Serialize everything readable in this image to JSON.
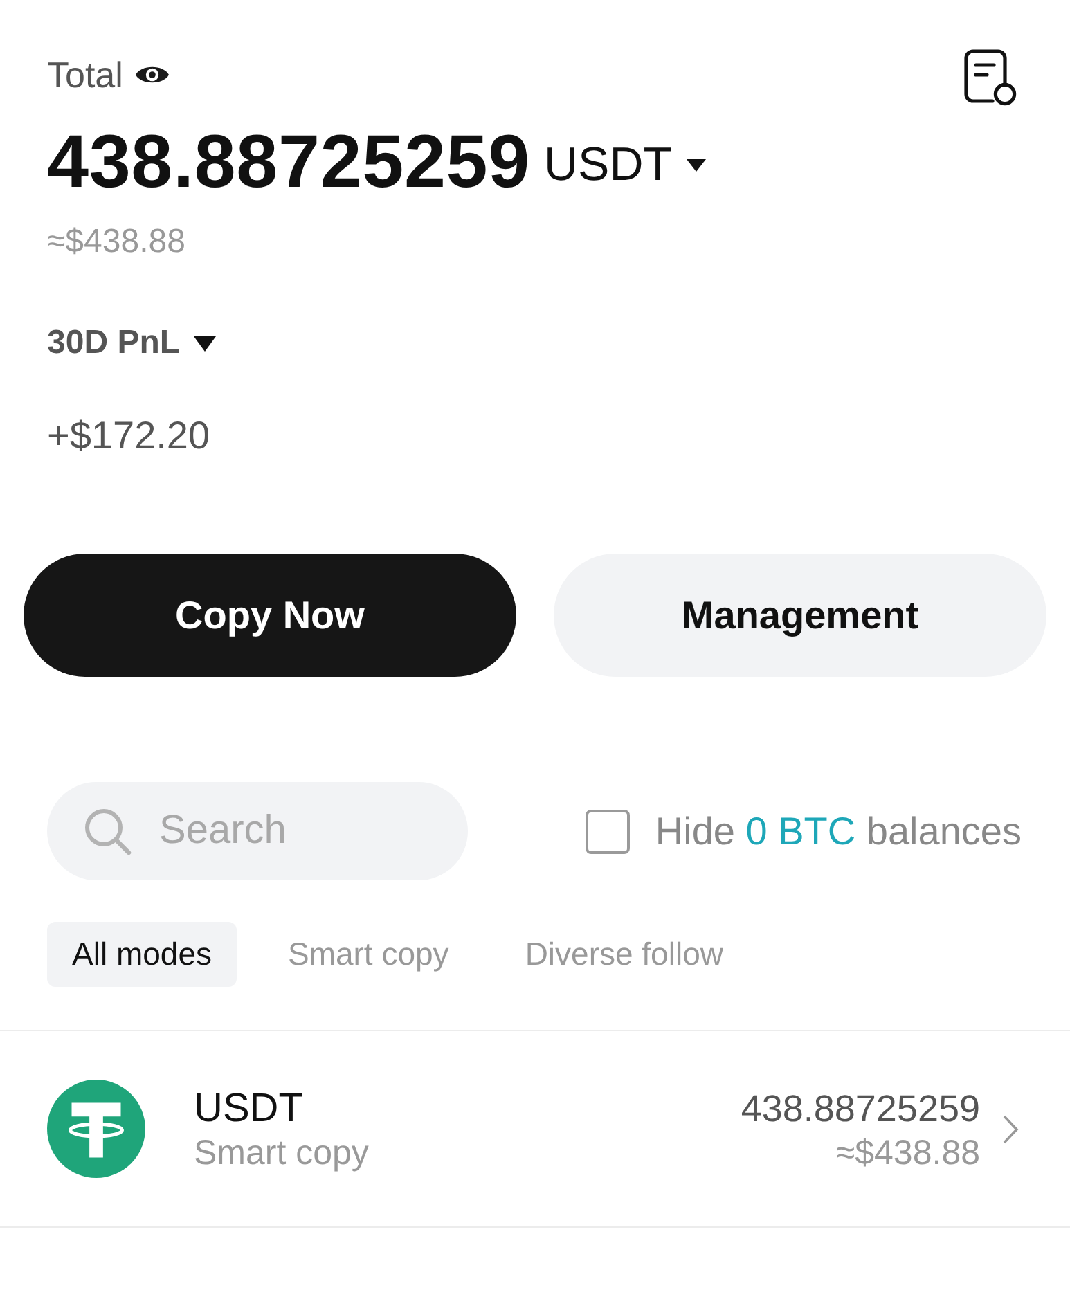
{
  "header": {
    "total_label": "Total",
    "balance_visible": true,
    "balance": "438.88725259",
    "currency": "USDT",
    "fiat_estimate": "≈$438.88"
  },
  "pnl": {
    "period_label": "30D PnL",
    "value": "+$172.20"
  },
  "buttons": [
    {
      "label": "Copy Now",
      "kind": "primary"
    },
    {
      "label": "Management",
      "kind": "secondary"
    }
  ],
  "search": {
    "placeholder": "Search"
  },
  "hide_balances": {
    "checked": false,
    "text_before": "Hide",
    "highlight": "0 BTC",
    "text_after": "balances"
  },
  "mode_tabs": [
    {
      "label": "All modes",
      "selected": true
    },
    {
      "label": "Smart copy",
      "selected": false
    },
    {
      "label": "Diverse follow",
      "selected": false
    }
  ],
  "assets": [
    {
      "symbol": "USDT",
      "mode": "Smart copy",
      "amount": "438.88725259",
      "fiat_estimate": "≈$438.88"
    }
  ]
}
